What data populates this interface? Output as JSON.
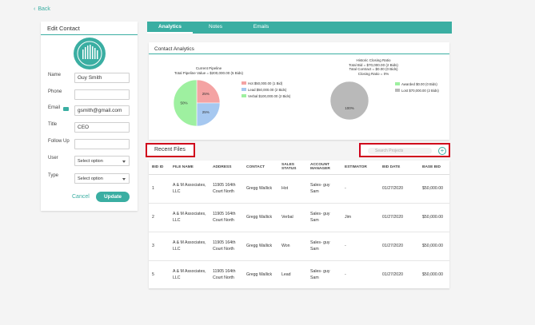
{
  "nav": {
    "back_label": "Back"
  },
  "contact_card": {
    "title": "Edit Contact",
    "fields": {
      "name_label": "Name",
      "name_value": "Guy Smith",
      "phone_label": "Phone",
      "phone_value": "",
      "email_label": "Email",
      "email_value": "gsmith@gmail.com",
      "title_label": "Title",
      "title_value": "CEO",
      "followup_label": "Follow Up",
      "followup_value": "",
      "user_label": "User",
      "user_value": "Select option",
      "type_label": "Type",
      "type_value": "Select option"
    },
    "cancel_label": "Cancel",
    "update_label": "Update"
  },
  "tabs": [
    {
      "label": "Analytics",
      "active": true
    },
    {
      "label": "Notes",
      "active": false
    },
    {
      "label": "Emails",
      "active": false
    }
  ],
  "analytics": {
    "title": "Contact Analytics",
    "pipeline": {
      "title_line1": "Current Pipeline",
      "title_line2": "Total Pipeline Value = $200,000.00 (5 Bids)",
      "legend": [
        {
          "label": "Hot $50,000.00 (1 Bid)",
          "color": "#f4a3a3"
        },
        {
          "label": "Lead $50,000.00 (2 Bids)",
          "color": "#a6c8f0"
        },
        {
          "label": "Verbal $100,000.00 (2 Bids)",
          "color": "#9ef0a0"
        }
      ],
      "slice_labels": [
        "25%",
        "25%",
        "50%"
      ]
    },
    "closing": {
      "title_line1": "Historic Closing Ratio",
      "title_line2": "Total Bid = $70,000.00 (2 Bids)",
      "title_line3": "Total Contract = $0.00 (0 Bids)",
      "title_line4": "Closing Ratio = 0%",
      "legend": [
        {
          "label": "Awarded $0.00 (0 Bids)",
          "color": "#9ef0a0"
        },
        {
          "label": "Lost $70,000.00 (2 Bids)",
          "color": "#b9b9b9"
        }
      ],
      "slice_label": "100%"
    }
  },
  "chart_data": [
    {
      "type": "pie",
      "title": "Current Pipeline",
      "subtitle": "Total Pipeline Value = $200,000.00 (5 Bids)",
      "categories": [
        "Hot",
        "Lead",
        "Verbal"
      ],
      "values": [
        50000,
        50000,
        100000
      ],
      "percent": [
        25,
        25,
        50
      ],
      "colors": [
        "#f4a3a3",
        "#a6c8f0",
        "#9ef0a0"
      ],
      "legend_position": "right"
    },
    {
      "type": "pie",
      "title": "Historic Closing Ratio",
      "categories": [
        "Awarded",
        "Lost"
      ],
      "values": [
        0,
        70000
      ],
      "percent": [
        0,
        100
      ],
      "colors": [
        "#9ef0a0",
        "#b9b9b9"
      ],
      "legend_position": "right"
    }
  ],
  "files": {
    "title": "Recent Files",
    "search_placeholder": "Search Projects",
    "columns": [
      "BID ID",
      "FILE NAME",
      "ADDRESS",
      "CONTACT",
      "SALES STATUS",
      "ACCOUNT MANAGER",
      "ESTIMATOR",
      "BID DATE",
      "BASE BID"
    ],
    "rows": [
      [
        "1",
        "A & M Associates, LLC",
        "11905 164th Court North",
        "Gregg Wallick",
        "Hot",
        "Sales- guy Sam",
        "-",
        "01/27/2020",
        "$50,000.00"
      ],
      [
        "2",
        "A & M Associates, LLC",
        "11905 164th Court North",
        "Gregg Wallick",
        "Verbal",
        "Sales- guy Sam",
        "Jim",
        "01/27/2020",
        "$50,000.00"
      ],
      [
        "3",
        "A & M Associates, LLC",
        "11905 164th Court North",
        "Gregg Wallick",
        "Won",
        "Sales- guy Sam",
        "-",
        "01/27/2020",
        "$50,000.00"
      ],
      [
        "5",
        "A & M Associates, LLC",
        "11905 164th Court North",
        "Gregg Wallick",
        "Lead",
        "Sales- guy Sam",
        "-",
        "01/27/2020",
        "$50,000.00"
      ]
    ]
  },
  "colors": {
    "accent": "#3aaea2",
    "highlight_border": "#d0021b"
  }
}
